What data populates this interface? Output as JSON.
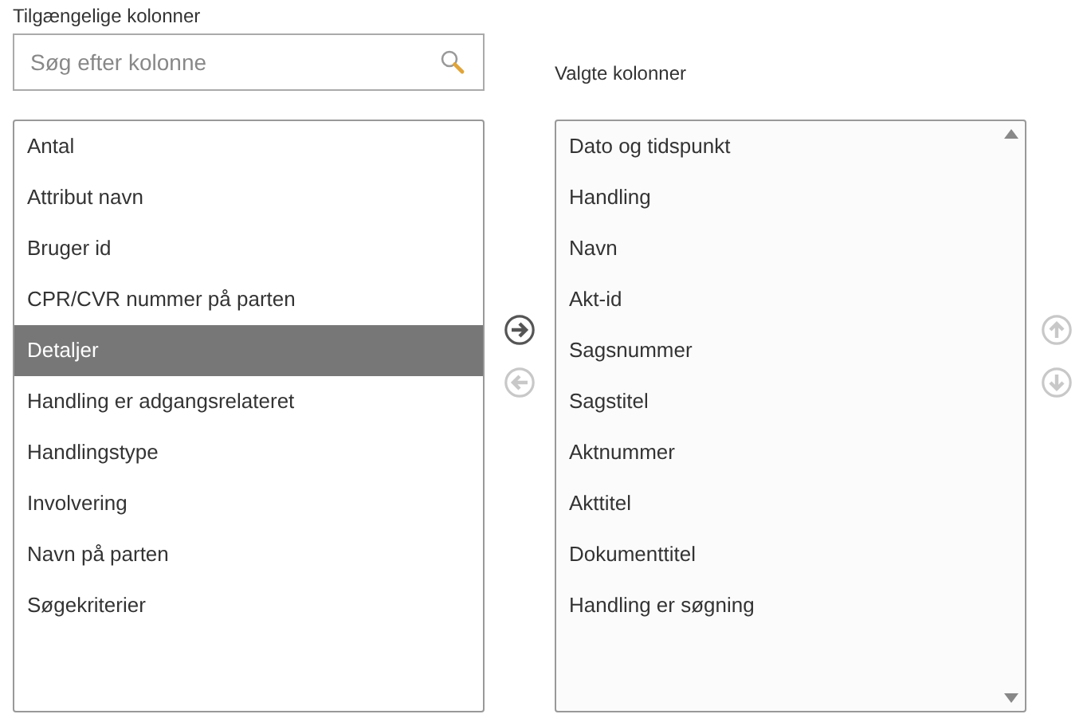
{
  "available": {
    "label": "Tilgængelige kolonner",
    "search": {
      "placeholder": "Søg efter kolonne"
    },
    "items": [
      {
        "label": "Antal",
        "selected": false
      },
      {
        "label": "Attribut navn",
        "selected": false
      },
      {
        "label": "Bruger id",
        "selected": false
      },
      {
        "label": "CPR/CVR nummer på parten",
        "selected": false
      },
      {
        "label": "Detaljer",
        "selected": true
      },
      {
        "label": "Handling er adgangsrelateret",
        "selected": false
      },
      {
        "label": "Handlingstype",
        "selected": false
      },
      {
        "label": "Involvering",
        "selected": false
      },
      {
        "label": "Navn på parten",
        "selected": false
      },
      {
        "label": "Søgekriterier",
        "selected": false
      }
    ]
  },
  "move_buttons": [
    {
      "kind": "right",
      "disabled": false
    },
    {
      "kind": "left",
      "disabled": true
    }
  ],
  "chosen": {
    "label": "Valgte kolonner",
    "items": [
      {
        "label": "Dato og tidspunkt",
        "selected": false
      },
      {
        "label": "Handling",
        "selected": false
      },
      {
        "label": "Navn",
        "selected": false
      },
      {
        "label": "Akt-id",
        "selected": false
      },
      {
        "label": "Sagsnummer",
        "selected": false
      },
      {
        "label": "Sagstitel",
        "selected": false
      },
      {
        "label": "Aktnummer",
        "selected": false
      },
      {
        "label": "Akttitel",
        "selected": false
      },
      {
        "label": "Dokumenttitel",
        "selected": false
      },
      {
        "label": "Handling er søgning",
        "selected": false
      }
    ]
  },
  "order_buttons": [
    {
      "kind": "up",
      "disabled": true
    },
    {
      "kind": "down",
      "disabled": true
    }
  ]
}
